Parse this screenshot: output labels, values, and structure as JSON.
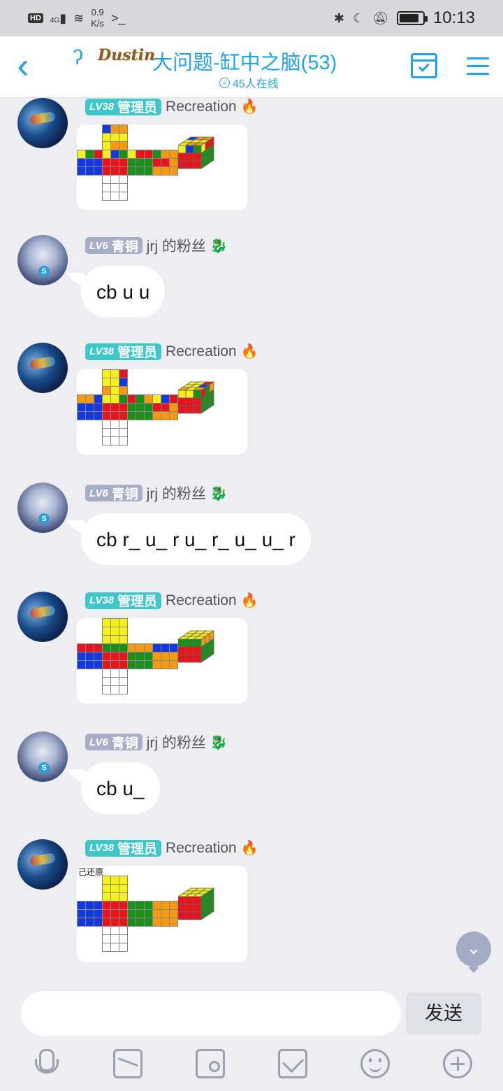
{
  "status": {
    "network": "4G",
    "speed_value": "0.9",
    "speed_unit": "K/s",
    "prompt": ">_",
    "time": "10:13",
    "battery_level": 0.85
  },
  "header": {
    "logo": "Dustin",
    "title": "大问题-缸中之脑(53)",
    "online": "45人在线"
  },
  "messages": [
    {
      "type": "image",
      "user": "Recreation",
      "level": "LV38",
      "role": "管理员",
      "caption": "",
      "cube": "s1"
    },
    {
      "type": "text",
      "user": "jrj 的粉丝",
      "level": "LV6",
      "role": "青铜",
      "text": "cb u u"
    },
    {
      "type": "image",
      "user": "Recreation",
      "level": "LV38",
      "role": "管理员",
      "caption": "",
      "cube": "s2"
    },
    {
      "type": "text",
      "user": "jrj 的粉丝",
      "level": "LV6",
      "role": "青铜",
      "text": "cb r_ u_ r u_ r_ u_ u_ r"
    },
    {
      "type": "image",
      "user": "Recreation",
      "level": "LV38",
      "role": "管理员",
      "caption": "",
      "cube": "s3"
    },
    {
      "type": "text",
      "user": "jrj 的粉丝",
      "level": "LV6",
      "role": "青铜",
      "text": "cb u_"
    },
    {
      "type": "image",
      "user": "Recreation",
      "level": "LV38",
      "role": "管理员",
      "caption": "己还原",
      "cube": "s4"
    }
  ],
  "cube_colors": {
    "Y": "#f7f01a",
    "B": "#1438e0",
    "R": "#e8141c",
    "G": "#1a8f1a",
    "O": "#f59a10",
    "W": "#ffffff"
  },
  "cube_states": {
    "s1": {
      "U": "BOOYYYYOO",
      "L": "YGRBBBBBB",
      "F": "YBGRRRRRR",
      "R": "YRRGGGGGG",
      "B": "GOORROOOO",
      "D": "WWWWWWWWW"
    },
    "s2": {
      "U": "YYRYYBOYO",
      "L": "OOBBBBBBB",
      "F": "YYGRRRRRR",
      "R": "RGOGGGGGG",
      "B": "YBRRROOOO",
      "D": "WWWWWWWWW"
    },
    "s3": {
      "U": "YYYYYYYYY",
      "L": "RRRBBBBBB",
      "F": "GGGRRRRRR",
      "R": "OOOGGGGGG",
      "B": "BBBOOOOOO",
      "D": "WWWWWWWWW"
    },
    "s4": {
      "U": "YYYYYYYYY",
      "L": "BBBBBBBBB",
      "F": "RRRRRRRRR",
      "R": "GGGGGGGGG",
      "B": "OOOOOOOOO",
      "D": "WWWWWWWWW"
    }
  },
  "input": {
    "placeholder": "",
    "send_label": "发送"
  }
}
